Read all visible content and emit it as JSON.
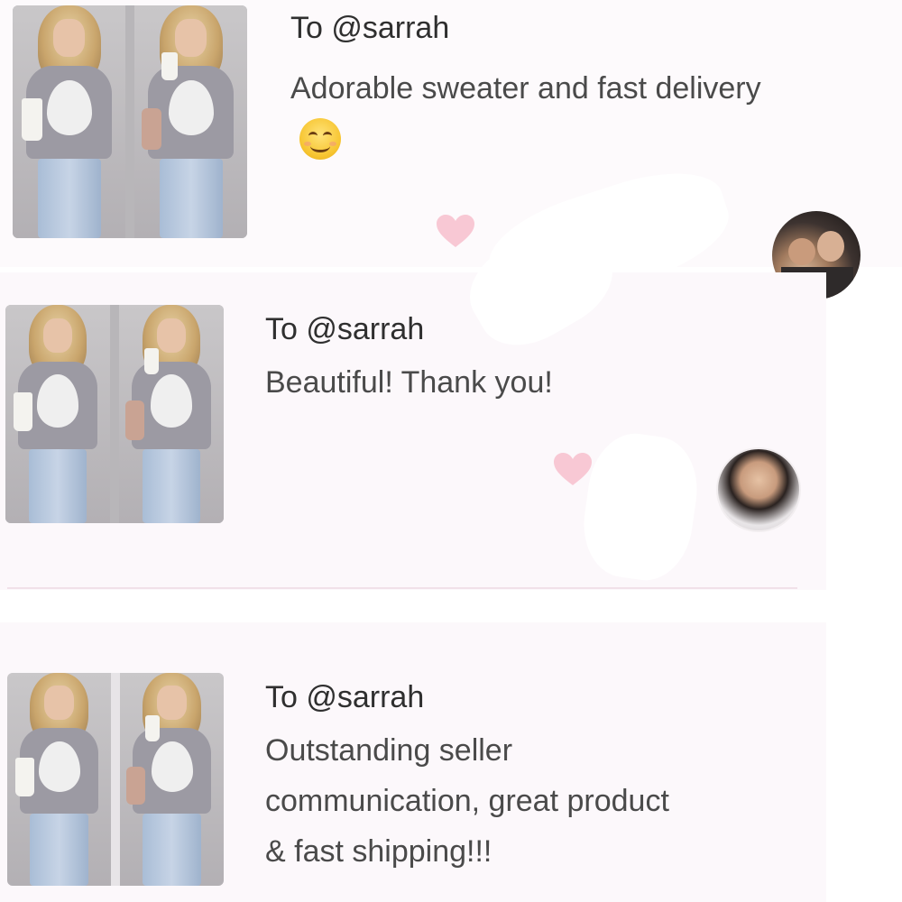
{
  "reviews": [
    {
      "recipient": "To @sarrah",
      "text": "Adorable sweater and fast delivery",
      "emoji": "smiling-face-icon"
    },
    {
      "recipient": "To @sarrah",
      "text": "Beautiful! Thank you!"
    },
    {
      "recipient": "To @sarrah",
      "lines": [
        "Outstanding seller",
        "communication, great product",
        "& fast shipping!!!"
      ]
    }
  ],
  "colors": {
    "heart": "#f8c8d4",
    "card_bg": "#fcf8fb",
    "text": "#4a4a4a"
  }
}
